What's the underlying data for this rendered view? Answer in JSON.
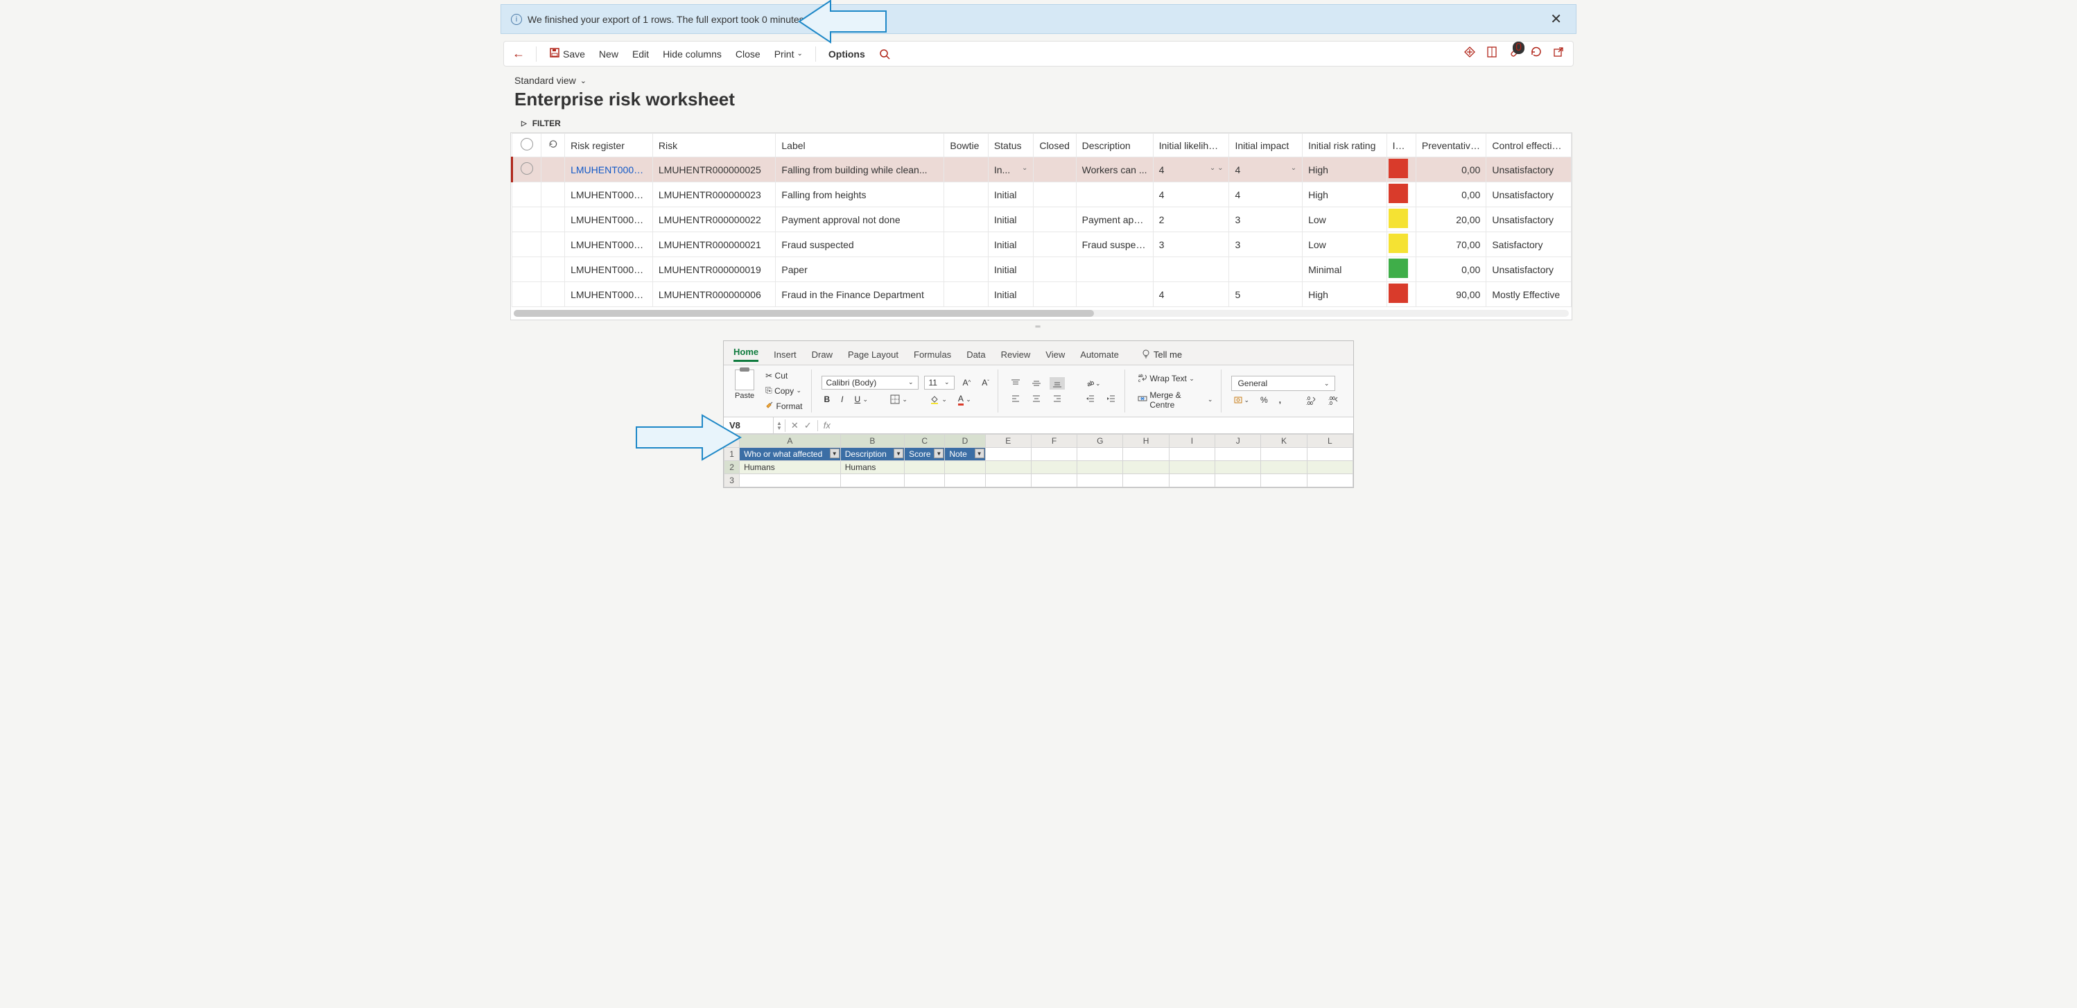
{
  "notification": {
    "message": "We finished your export of 1 rows. The full export took 0 minutes."
  },
  "toolbar": {
    "save": "Save",
    "new": "New",
    "edit": "Edit",
    "hide_columns": "Hide columns",
    "close": "Close",
    "print": "Print",
    "options": "Options",
    "attachment_count": "0"
  },
  "view": {
    "name": "Standard view",
    "title": "Enterprise risk worksheet",
    "filter_label": "FILTER"
  },
  "grid": {
    "columns": [
      "Risk register",
      "Risk",
      "Label",
      "Bowtie",
      "Status",
      "Closed",
      "Description",
      "Initial likelihood",
      "Initial impact",
      "Initial risk rating",
      "Initial risk",
      "Preventative c...",
      "Control effectivene"
    ],
    "rows": [
      {
        "selected": true,
        "register": "LMUHENT0000...",
        "risk": "LMUHENTR000000025",
        "label": "Falling from building while clean...",
        "bowtie": "",
        "status": "In...",
        "closed": "",
        "description": "Workers can ...",
        "likelihood": "4",
        "impact": "4",
        "rating": "High",
        "color": "#d93b2b",
        "prev": "0,00",
        "ctrl": "Unsatisfactory",
        "link": true,
        "dropdowns": true
      },
      {
        "register": "LMUHENT0000...",
        "risk": "LMUHENTR000000023",
        "label": "Falling from  heights",
        "bowtie": "",
        "status": "Initial",
        "closed": "",
        "description": "",
        "likelihood": "4",
        "impact": "4",
        "rating": "High",
        "color": "#d93b2b",
        "prev": "0,00",
        "ctrl": "Unsatisfactory"
      },
      {
        "register": "LMUHENT0000...",
        "risk": "LMUHENTR000000022",
        "label": "Payment approval not done",
        "bowtie": "",
        "status": "Initial",
        "closed": "",
        "description": "Payment app...",
        "likelihood": "2",
        "impact": "3",
        "rating": "Low",
        "color": "#f5e233",
        "prev": "20,00",
        "ctrl": "Unsatisfactory"
      },
      {
        "register": "LMUHENT0000...",
        "risk": "LMUHENTR000000021",
        "label": "Fraud suspected",
        "bowtie": "",
        "status": "Initial",
        "closed": "",
        "description": "Fraud suspec...",
        "likelihood": "3",
        "impact": "3",
        "rating": "Low",
        "color": "#f5e233",
        "prev": "70,00",
        "ctrl": "Satisfactory"
      },
      {
        "register": "LMUHENT0000...",
        "risk": "LMUHENTR000000019",
        "label": "Paper",
        "bowtie": "",
        "status": "Initial",
        "closed": "",
        "description": "",
        "likelihood": "",
        "impact": "",
        "rating": "Minimal",
        "color": "#3fae49",
        "prev": "0,00",
        "ctrl": "Unsatisfactory"
      },
      {
        "register": "LMUHENT0000...",
        "risk": "LMUHENTR000000006",
        "label": "Fraud in the Finance Department",
        "bowtie": "",
        "status": "Initial",
        "closed": "",
        "description": "",
        "likelihood": "4",
        "impact": "5",
        "rating": "High",
        "color": "#d93b2b",
        "prev": "90,00",
        "ctrl": "Mostly Effective"
      }
    ]
  },
  "excel": {
    "tabs": [
      "Home",
      "Insert",
      "Draw",
      "Page Layout",
      "Formulas",
      "Data",
      "Review",
      "View",
      "Automate"
    ],
    "tellme": "Tell me",
    "clipboard": {
      "paste": "Paste",
      "cut": "Cut",
      "copy": "Copy",
      "format": "Format"
    },
    "font": {
      "name": "Calibri (Body)",
      "size": "11"
    },
    "align": {
      "wrap": "Wrap Text",
      "merge": "Merge & Centre"
    },
    "number": {
      "format": "General"
    },
    "namebox": "V8",
    "sheet": {
      "cols": [
        "A",
        "B",
        "C",
        "D",
        "E",
        "F",
        "G",
        "H",
        "I",
        "J",
        "K",
        "L"
      ],
      "header_row": [
        "Who or what affected",
        "Description",
        "Score",
        "Note"
      ],
      "data_row": [
        "Humans",
        "Humans",
        "",
        ""
      ]
    }
  }
}
